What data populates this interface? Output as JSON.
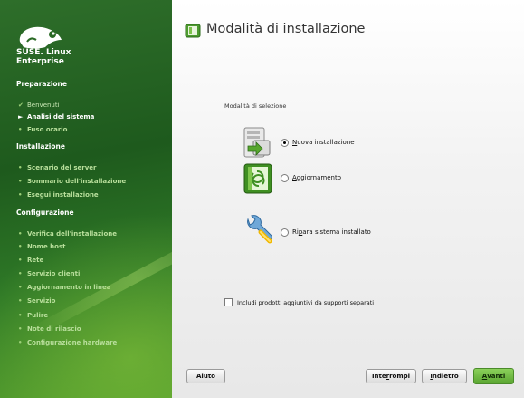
{
  "sidebar": {
    "brand_line1": "SUSE. Linux",
    "brand_line2": "Enterprise",
    "sections": [
      {
        "title": "Preparazione",
        "items": [
          {
            "label": "Benvenuti",
            "state": "done"
          },
          {
            "label": "Analisi del sistema",
            "state": "current"
          },
          {
            "label": "Fuso orario",
            "state": "todo"
          }
        ]
      },
      {
        "title": "Installazione",
        "items": [
          {
            "label": "Scenario del server",
            "state": "todo"
          },
          {
            "label": "Sommario dell'installazione",
            "state": "todo"
          },
          {
            "label": "Esegui installazione",
            "state": "todo"
          }
        ]
      },
      {
        "title": "Configurazione",
        "items": [
          {
            "label": "Verifica dell'installazione",
            "state": "todo"
          },
          {
            "label": "Nome host",
            "state": "todo"
          },
          {
            "label": "Rete",
            "state": "todo"
          },
          {
            "label": "Servizio clienti",
            "state": "todo"
          },
          {
            "label": "Aggiornamento in linea",
            "state": "todo"
          },
          {
            "label": "Servizio",
            "state": "todo"
          },
          {
            "label": "Pulire",
            "state": "todo"
          },
          {
            "label": "Note di rilascio",
            "state": "todo"
          },
          {
            "label": "Configurazione hardware",
            "state": "todo"
          }
        ]
      }
    ]
  },
  "main": {
    "title": "Modalità di installazione",
    "group_label": "Modalità di selezione",
    "options": [
      {
        "label": "Nuova installazione",
        "mnemonic": "N",
        "rest": "uova installazione",
        "checked": true,
        "icon": "new-install-icon"
      },
      {
        "label": "Aggiornamento",
        "mnemonic": "A",
        "rest": "ggiornamento",
        "checked": false,
        "icon": "update-icon"
      },
      {
        "label": "Ripara sistema installato",
        "pre": "Ri",
        "mnemonic": "p",
        "rest": "ara sistema installato",
        "checked": false,
        "icon": "repair-icon"
      }
    ],
    "addon_checkbox": {
      "pre": "I",
      "mnemonic": "n",
      "rest": "cludi prodotti aggiuntivi da supporti separati",
      "checked": false
    }
  },
  "buttons": {
    "help": "Aiuto",
    "abort_pre": "Inte",
    "abort_mnemonic": "r",
    "abort_rest": "rompi",
    "back_mnemonic": "I",
    "back_rest": "ndietro",
    "next_mnemonic": "A",
    "next_rest": "vanti"
  },
  "colors": {
    "sidebar_green": "#1e5a1d",
    "accent_green": "#5aa531",
    "nav_text": "#b9df9c"
  }
}
